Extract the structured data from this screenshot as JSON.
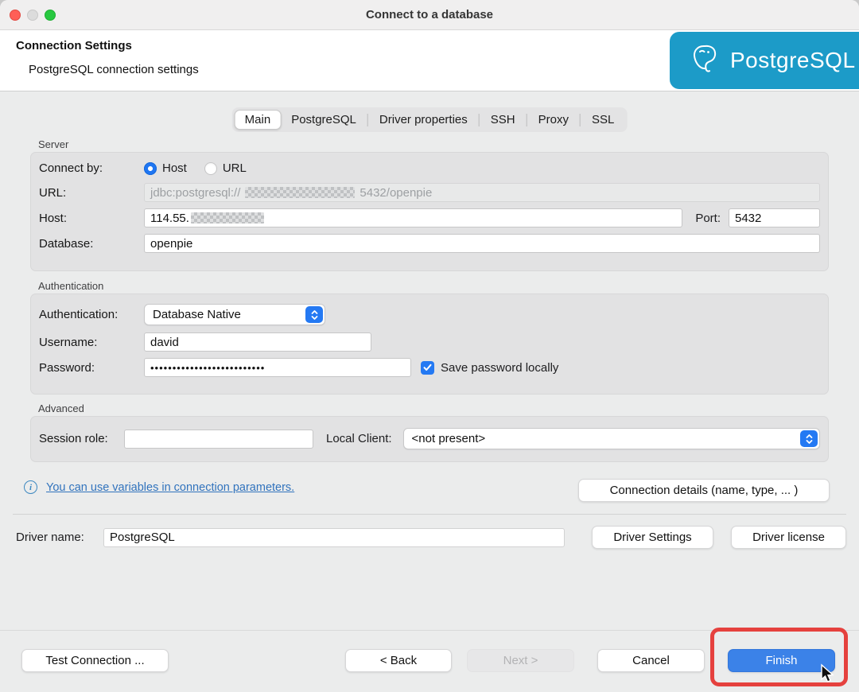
{
  "window": {
    "title": "Connect to a database"
  },
  "header": {
    "title": "Connection Settings",
    "subtitle": "PostgreSQL connection settings",
    "logo_text": "PostgreSQL",
    "logo_bg": "#1c9bc8"
  },
  "tabs": [
    {
      "label": "Main",
      "active": true
    },
    {
      "label": "PostgreSQL",
      "active": false
    },
    {
      "label": "Driver properties",
      "active": false
    },
    {
      "label": "SSH",
      "active": false
    },
    {
      "label": "Proxy",
      "active": false
    },
    {
      "label": "SSL",
      "active": false
    }
  ],
  "server": {
    "section_label": "Server",
    "connect_by_label": "Connect by:",
    "radio_host_label": "Host",
    "radio_url_label": "URL",
    "selected_radio": "Host",
    "url_label": "URL:",
    "url_prefix": "jdbc:postgresql://",
    "url_suffix": "5432/openpie",
    "host_label": "Host:",
    "host_prefix": "114.55.",
    "port_label": "Port:",
    "port_value": "5432",
    "database_label": "Database:",
    "database_value": "openpie"
  },
  "authentication": {
    "section_label": "Authentication",
    "auth_label": "Authentication:",
    "auth_value": "Database Native",
    "username_label": "Username:",
    "username_value": "david",
    "password_label": "Password:",
    "password_value": "••••••••••••••••••••••••••",
    "save_password_label": "Save password locally",
    "save_password_checked": true
  },
  "advanced": {
    "section_label": "Advanced",
    "session_role_label": "Session role:",
    "session_role_value": "",
    "local_client_label": "Local Client:",
    "local_client_value": "<not present>"
  },
  "footer_links": {
    "variables_link": "You can use variables in connection parameters.",
    "connection_details_button": "Connection details (name, type, ... )"
  },
  "driver": {
    "label": "Driver name:",
    "value": "PostgreSQL",
    "settings_button": "Driver Settings",
    "license_button": "Driver license"
  },
  "actions": {
    "test_connection": "Test Connection ...",
    "back": "< Back",
    "next": "Next >",
    "cancel": "Cancel",
    "finish": "Finish"
  },
  "colors": {
    "accent_blue": "#2479f3",
    "finish_blue": "#3b82e8",
    "banner_blue": "#1c9bc8",
    "annotation_red": "#e5413e",
    "link_blue": "#3173bd"
  }
}
